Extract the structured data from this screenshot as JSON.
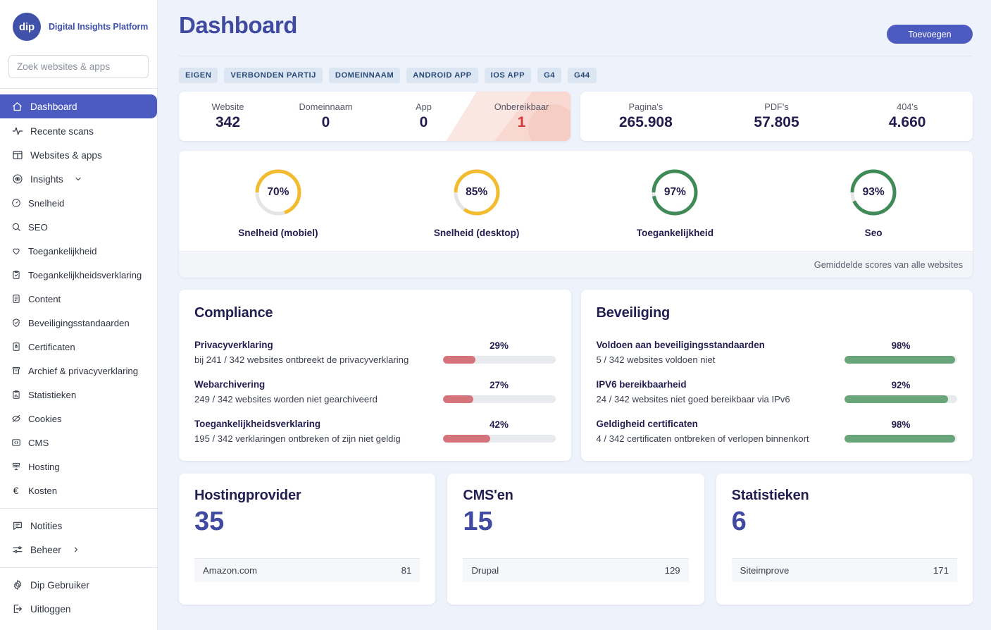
{
  "brand": {
    "logo_text": "dip",
    "name": "Digital Insights Platform"
  },
  "search": {
    "placeholder": "Zoek websites & apps",
    "value": ""
  },
  "sidebar": {
    "primary": [
      {
        "label": "Dashboard",
        "icon": "home-icon",
        "active": true
      },
      {
        "label": "Recente scans",
        "icon": "activity-icon",
        "active": false
      },
      {
        "label": "Websites & apps",
        "icon": "browser-icon",
        "active": false
      },
      {
        "label": "Insights",
        "icon": "eye-icon",
        "active": false,
        "chevron": "chevron-down"
      }
    ],
    "insights": [
      {
        "label": "Snelheid",
        "icon": "gauge-icon"
      },
      {
        "label": "SEO",
        "icon": "search-icon"
      },
      {
        "label": "Toegankelijkheid",
        "icon": "heart-icon"
      },
      {
        "label": "Toegankelijkheidsverklaring",
        "icon": "clipboard-check-icon"
      },
      {
        "label": "Content",
        "icon": "document-icon"
      },
      {
        "label": "Beveiligingsstandaarden",
        "icon": "shield-check-icon"
      },
      {
        "label": "Certificaten",
        "icon": "certificate-lock-icon"
      },
      {
        "label": "Archief & privacyverklaring",
        "icon": "archive-icon"
      },
      {
        "label": "Statistieken",
        "icon": "chart-clipboard-icon"
      },
      {
        "label": "Cookies",
        "icon": "cookie-eye-off-icon"
      },
      {
        "label": "CMS",
        "icon": "code-box-icon"
      },
      {
        "label": "Hosting",
        "icon": "server-icon"
      },
      {
        "label": "Kosten",
        "icon": "euro-icon"
      }
    ],
    "secondary": [
      {
        "label": "Notities",
        "icon": "note-icon"
      },
      {
        "label": "Beheer",
        "icon": "sliders-icon",
        "chevron": "chevron-right"
      }
    ],
    "footer": [
      {
        "label": "Dip Gebruiker",
        "icon": "gear-icon"
      },
      {
        "label": "Uitloggen",
        "icon": "logout-icon"
      }
    ]
  },
  "header": {
    "title": "Dashboard",
    "add_button": "Toevoegen"
  },
  "filters": [
    "EIGEN",
    "VERBONDEN PARTIJ",
    "DOMEINNAAM",
    "ANDROID APP",
    "IOS APP",
    "G4",
    "G44"
  ],
  "stats_left": [
    {
      "label": "Website",
      "value": "342",
      "danger": false
    },
    {
      "label": "Domeinnaam",
      "value": "0",
      "danger": false
    },
    {
      "label": "App",
      "value": "0",
      "danger": false
    },
    {
      "label": "Onbereikbaar",
      "value": "1",
      "danger": true
    }
  ],
  "stats_right": [
    {
      "label": "Pagina's",
      "value": "265.908"
    },
    {
      "label": "PDF's",
      "value": "57.805"
    },
    {
      "label": "404's",
      "value": "4.660"
    }
  ],
  "gauges": {
    "items": [
      {
        "label": "Snelheid (mobiel)",
        "value": 70,
        "display": "70%",
        "color": "#f2bc2e"
      },
      {
        "label": "Snelheid (desktop)",
        "value": 85,
        "display": "85%",
        "color": "#f2bc2e"
      },
      {
        "label": "Toegankelijkheid",
        "value": 97,
        "display": "97%",
        "color": "#3f8a57"
      },
      {
        "label": "Seo",
        "value": 93,
        "display": "93%",
        "color": "#3f8a57"
      }
    ],
    "footnote": "Gemiddelde scores van alle websites",
    "track_color": "#e5e5e7"
  },
  "compliance": {
    "title": "Compliance",
    "bar_color": "#d4737a",
    "items": [
      {
        "name": "Privacyverklaring",
        "desc": "bij 241 / 342 websites ontbreekt de privacyverklaring",
        "pct": "29%",
        "value": 29
      },
      {
        "name": "Webarchivering",
        "desc": "249 / 342 websites worden niet gearchiveerd",
        "pct": "27%",
        "value": 27
      },
      {
        "name": "Toegankelijkheidsverklaring",
        "desc": "195 / 342 verklaringen ontbreken of zijn niet geldig",
        "pct": "42%",
        "value": 42
      }
    ]
  },
  "security": {
    "title": "Beveiliging",
    "bar_color": "#6aa579",
    "items": [
      {
        "name": "Voldoen aan beveiligingsstandaarden",
        "desc": "5 / 342 websites voldoen niet",
        "pct": "98%",
        "value": 98
      },
      {
        "name": "IPV6 bereikbaarheid",
        "desc": "24 / 342 websites niet goed bereikbaar via IPv6",
        "pct": "92%",
        "value": 92
      },
      {
        "name": "Geldigheid certificaten",
        "desc": "4 / 342 certificaten ontbreken of verlopen binnenkort",
        "pct": "98%",
        "value": 98
      }
    ]
  },
  "bottom": [
    {
      "title": "Hostingprovider",
      "count": "35",
      "rows": [
        {
          "name": "Amazon.com",
          "value": "81"
        }
      ]
    },
    {
      "title": "CMS'en",
      "count": "15",
      "rows": [
        {
          "name": "Drupal",
          "value": "129"
        }
      ]
    },
    {
      "title": "Statistieken",
      "count": "6",
      "rows": [
        {
          "name": "Siteimprove",
          "value": "171"
        }
      ]
    }
  ]
}
